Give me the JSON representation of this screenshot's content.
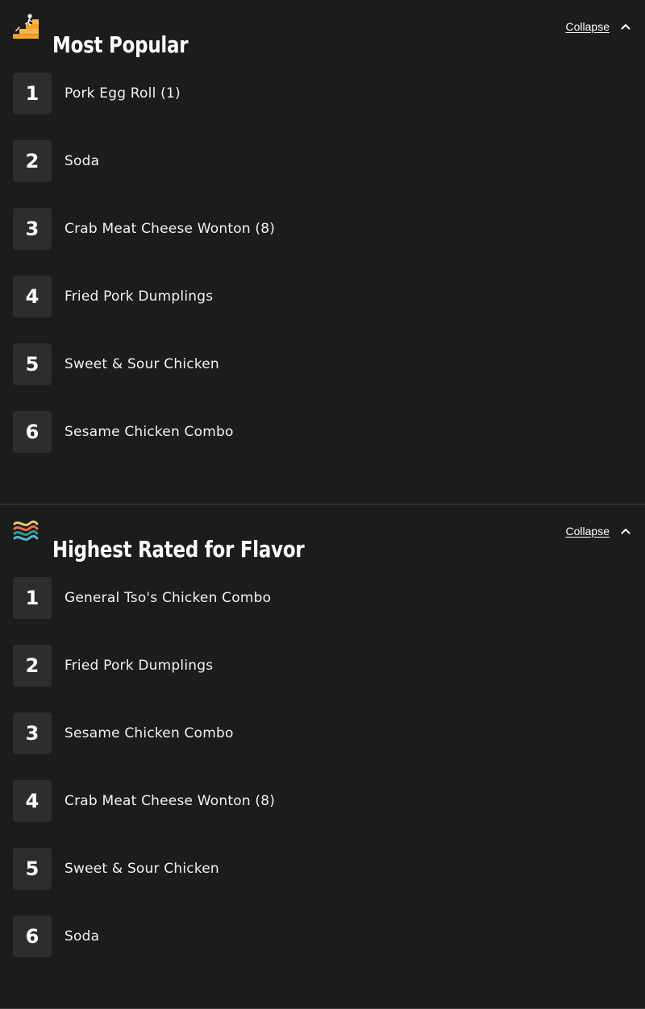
{
  "sections": [
    {
      "title": "Most Popular",
      "icon": "trending-stairs-icon",
      "collapse_label": "Collapse",
      "items": [
        {
          "rank": "1",
          "name": "Pork Egg Roll (1)"
        },
        {
          "rank": "2",
          "name": "Soda"
        },
        {
          "rank": "3",
          "name": "Crab Meat Cheese Wonton (8)"
        },
        {
          "rank": "4",
          "name": "Fried Pork Dumplings"
        },
        {
          "rank": "5",
          "name": "Sweet & Sour Chicken"
        },
        {
          "rank": "6",
          "name": "Sesame Chicken Combo"
        }
      ]
    },
    {
      "title": "Highest Rated for Flavor",
      "icon": "flavor-waves-icon",
      "collapse_label": "Collapse",
      "items": [
        {
          "rank": "1",
          "name": "General Tso's Chicken Combo"
        },
        {
          "rank": "2",
          "name": "Fried Pork Dumplings"
        },
        {
          "rank": "3",
          "name": "Sesame Chicken Combo"
        },
        {
          "rank": "4",
          "name": "Crab Meat Cheese Wonton (8)"
        },
        {
          "rank": "5",
          "name": "Sweet & Sour Chicken"
        },
        {
          "rank": "6",
          "name": "Soda"
        }
      ]
    }
  ],
  "colors": {
    "background": "#1c1c1c",
    "rank_tile": "#2d2d2d",
    "divider": "#3c3c3c",
    "text": "#ffffff"
  }
}
